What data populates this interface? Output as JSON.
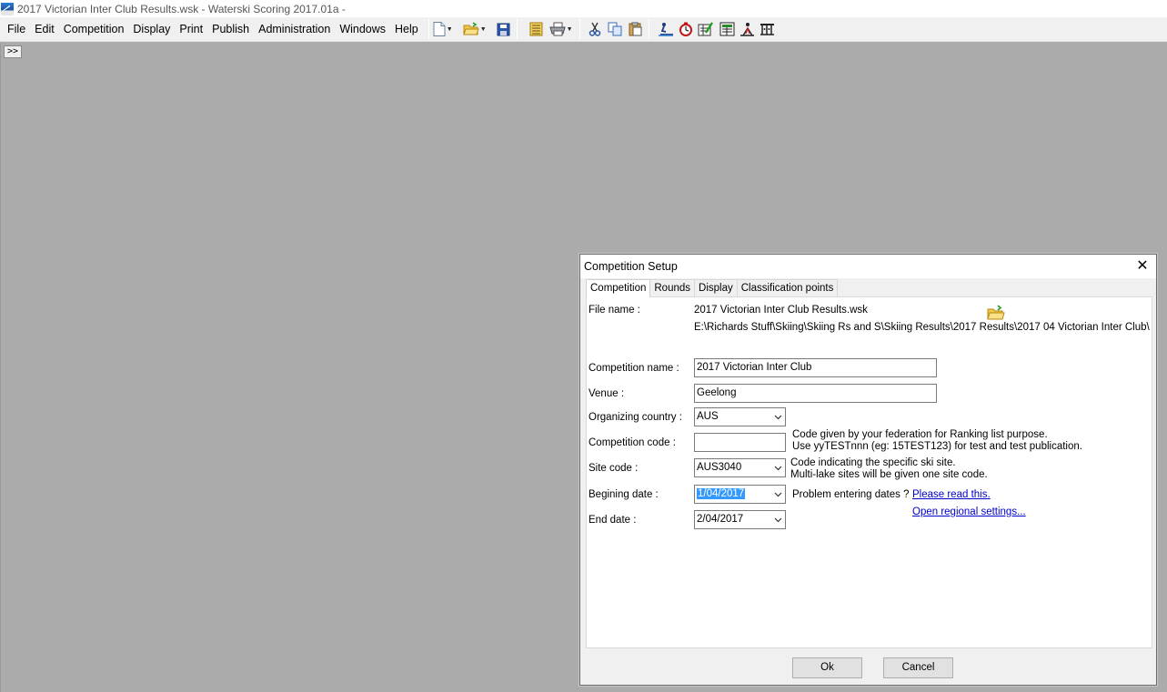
{
  "window": {
    "title": "2017 Victorian Inter Club Results.wsk - Waterski Scoring 2017.01a  -"
  },
  "menu": [
    "File",
    "Edit",
    "Competition",
    "Display",
    "Print",
    "Publish",
    "Administration",
    "Windows",
    "Help"
  ],
  "toolbar": {
    "icons": [
      "new-document-icon",
      "open-folder-icon",
      "save-icon",
      "report-icon",
      "print-icon",
      "cut-icon",
      "copy-icon",
      "paste-icon",
      "slalom-icon",
      "timer-icon",
      "trick-icon",
      "scoreboard-icon",
      "jump-icon",
      "tow-icon"
    ]
  },
  "mdi": {
    "expand_label": ">>"
  },
  "dialog": {
    "title": "Competition Setup",
    "close": "✕",
    "tabs": [
      "Competition",
      "Rounds",
      "Display",
      "Classification points"
    ],
    "active_tab": "Competition",
    "file_name_label": "File name :",
    "file_name": "2017 Victorian Inter Club Results.wsk",
    "file_path": "E:\\Richards Stuff\\Skiing\\Skiing Rs and S\\Skiing Results\\2017 Results\\2017 04 Victorian Inter Club\\",
    "competition_name_label": "Competition name :",
    "competition_name": "2017 Victorian Inter Club",
    "venue_label": "Venue :",
    "venue": "Geelong",
    "country_label": "Organizing country :",
    "country": "AUS",
    "code_label": "Competition code :",
    "code": "",
    "code_note_1": "Code given by your federation for Ranking list purpose.",
    "code_note_2": "Use yyTESTnnn (eg: 15TEST123) for test and test publication.",
    "site_label": "Site code :",
    "site": "AUS3040",
    "site_note_1": "Code indicating the specific ski site.",
    "site_note_2": "Multi-lake sites will be given one site code.",
    "begin_label": "Begining date :",
    "begin_date": "1/04/2017",
    "date_problem": "Problem entering dates ?",
    "read_link": "Please read this.",
    "regional_link": "Open regional settings...",
    "end_label": "End date :",
    "end_date": "2/04/2017",
    "ok": "Ok",
    "cancel": "Cancel"
  }
}
